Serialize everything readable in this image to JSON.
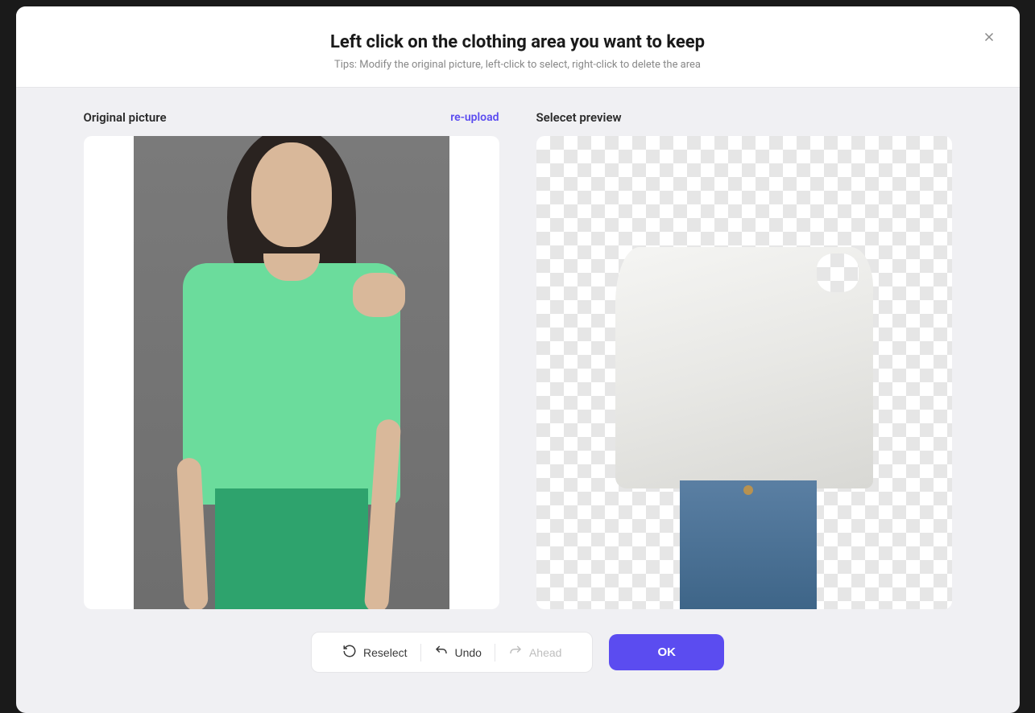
{
  "header": {
    "title": "Left click on the clothing area you want to keep",
    "tip": "Tips: Modify the original picture, left-click to select, right-click to delete the area"
  },
  "panels": {
    "original_label": "Original picture",
    "reupload_label": "re-upload",
    "preview_label": "Selecet preview"
  },
  "toolbar": {
    "reselect_label": "Reselect",
    "undo_label": "Undo",
    "ahead_label": "Ahead",
    "ok_label": "OK"
  }
}
